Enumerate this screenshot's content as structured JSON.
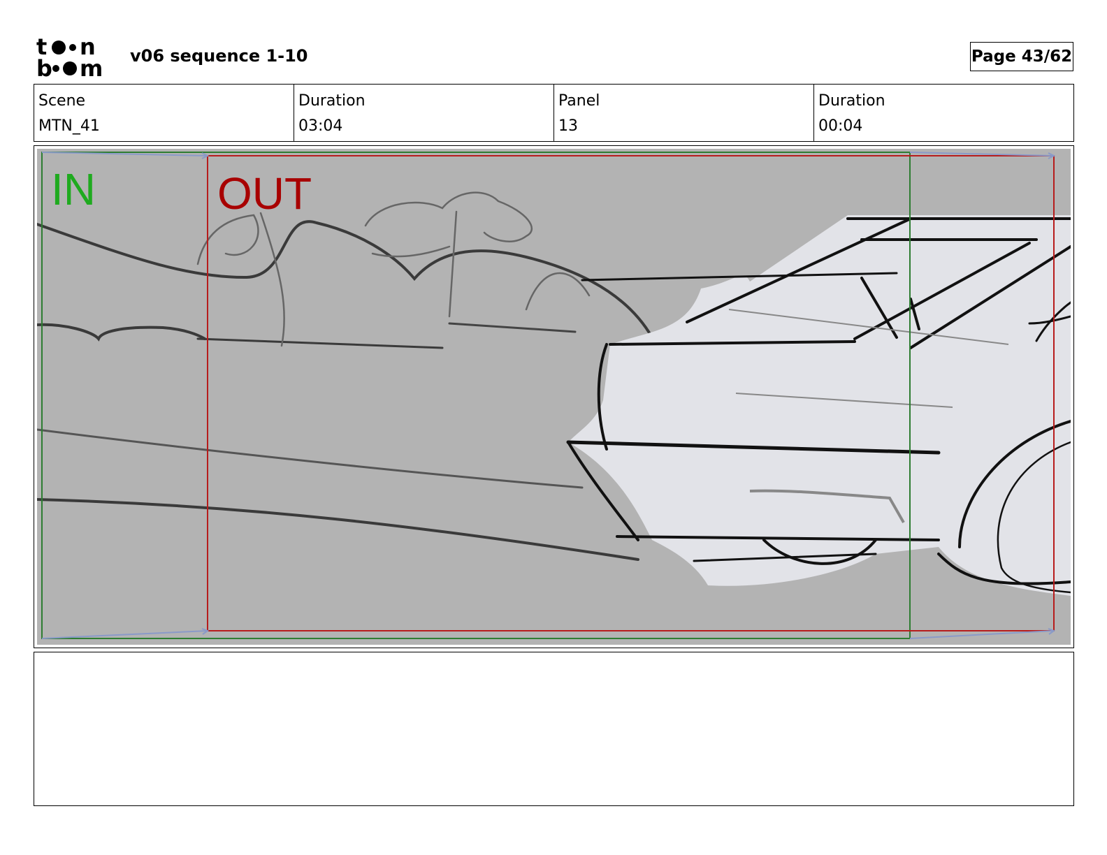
{
  "header": {
    "logo_text": "toon boom",
    "title": "v06 sequence 1-10",
    "page_label": "Page 43/62"
  },
  "info": [
    {
      "label": "Scene",
      "value": "MTN_41"
    },
    {
      "label": "Duration",
      "value": "03:04"
    },
    {
      "label": "Panel",
      "value": "13"
    },
    {
      "label": "Duration",
      "value": "00:04"
    }
  ],
  "panel": {
    "in_label": "IN",
    "out_label": "OUT",
    "colors": {
      "background": "#b3b3b3",
      "car_fill": "#e2e3e8",
      "in_frame": "#2e7d32",
      "out_frame": "#b71c1c",
      "camera_arrow": "#8a9ac8",
      "in_text": "#1faa1f",
      "out_text": "#a80000"
    }
  },
  "notes": {
    "text": ""
  }
}
